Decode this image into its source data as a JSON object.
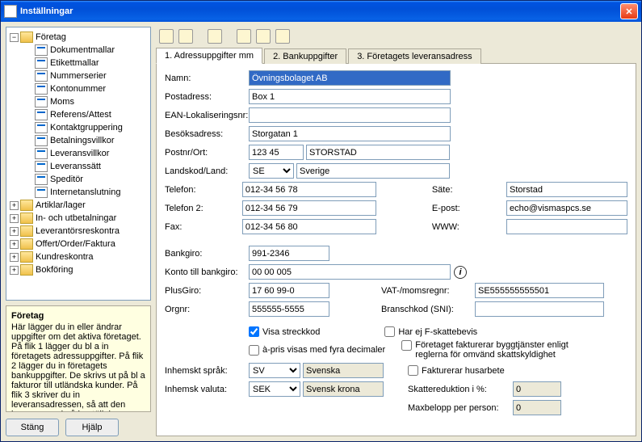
{
  "window": {
    "title": "Inställningar"
  },
  "tree": {
    "root": "Företag",
    "children": [
      "Dokumentmallar",
      "Etikettmallar",
      "Nummerserier",
      "Kontonummer",
      "Moms",
      "Referens/Attest",
      "Kontaktgruppering",
      "Betalningsvillkor",
      "Leveransvillkor",
      "Leveranssätt",
      "Speditör",
      "Internetanslutning"
    ],
    "siblings": [
      "Artiklar/lager",
      "In- och utbetalningar",
      "Leverantörsreskontra",
      "Offert/Order/Faktura",
      "Kundreskontra",
      "Bokföring"
    ]
  },
  "help": {
    "title": "Företag",
    "body": "Här lägger du in eller ändrar uppgifter om det aktiva företaget. På flik 1 lägger du bl a in företagets adressuppgifter. På flik 2 lägger du in företagets bankuppgifter. De skrivs ut på bl a fakturor till utländska kunder. På flik 3 skriver du in leveransadressen, så att den kommer med på beställningarna."
  },
  "buttons": {
    "close": "Stäng",
    "help": "Hjälp"
  },
  "tabs": [
    "1. Adressuppgifter mm",
    "2. Bankuppgifter",
    "3. Företagets leveransadress"
  ],
  "form": {
    "labels": {
      "namn": "Namn:",
      "postadress": "Postadress:",
      "ean": "EAN-Lokaliseringsnr:",
      "besok": "Besöksadress:",
      "postnr": "Postnr/Ort:",
      "land": "Landskod/Land:",
      "telefon": "Telefon:",
      "telefon2": "Telefon 2:",
      "fax": "Fax:",
      "sate": "Säte:",
      "epost": "E-post:",
      "www": "WWW:",
      "bankgiro": "Bankgiro:",
      "konto": "Konto till bankgiro:",
      "plusgiro": "PlusGiro:",
      "vat": "VAT-/momsregnr:",
      "orgnr": "Orgnr:",
      "bransch": "Branschkod (SNI):",
      "sprak": "Inhemskt språk:",
      "valuta": "Inhemsk valuta:",
      "skattered": "Skattereduktion i %:",
      "maxbelopp": "Maxbelopp per person:"
    },
    "values": {
      "namn": "Övningsbolaget AB",
      "postadress": "Box 1",
      "ean": "",
      "besok": "Storgatan 1",
      "postnr": "123 45",
      "ort": "STORSTAD",
      "landskod": "SE",
      "land": "Sverige",
      "telefon": "012-34 56 78",
      "telefon2": "012-34 56 79",
      "fax": "012-34 56 80",
      "sate": "Storstad",
      "epost": "echo@vismaspcs.se",
      "www": "",
      "bankgiro": "991-2346",
      "konto": "00 00 005",
      "plusgiro": "17 60 99-0",
      "vat": "SE555555555501",
      "orgnr": "555555-5555",
      "bransch": "",
      "sprak_code": "SV",
      "sprak_name": "Svenska",
      "valuta_code": "SEK",
      "valuta_name": "Svensk krona",
      "skattered": "0",
      "maxbelopp": "0"
    },
    "checks": {
      "streckkod": "Visa streckkod",
      "apris": "à-pris visas med fyra decimaler",
      "fskatt": "Har ej F-skattebevis",
      "bygg": "Företaget fakturerar byggtjänster enligt reglerna för omvänd skattskyldighet",
      "husarbete": "Fakturerar husarbete"
    }
  }
}
